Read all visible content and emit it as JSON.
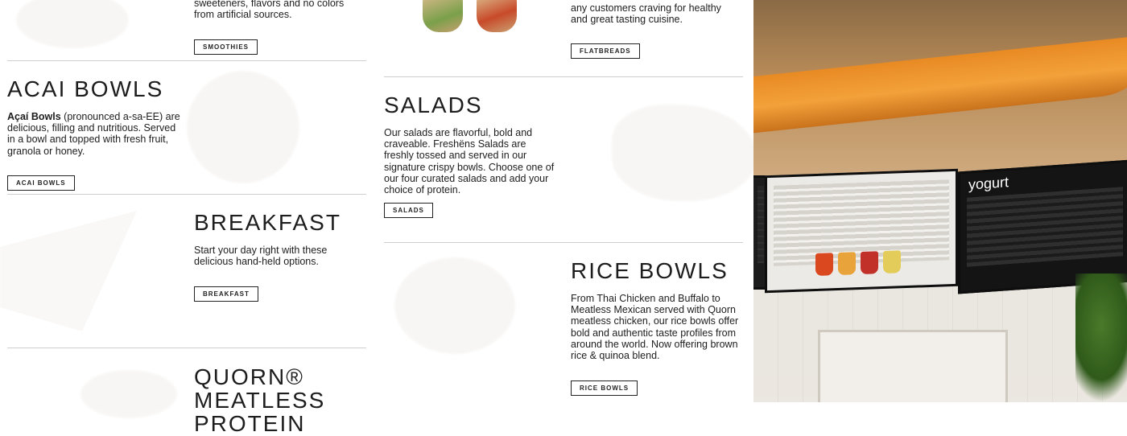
{
  "sections": {
    "smoothies": {
      "desc": "sweeteners, flavors and no colors from artificial sources.",
      "button": "SMOOTHIES"
    },
    "acai": {
      "title": "ACAI BOWLS",
      "desc_bold": "Açaí Bowls",
      "desc": " (pronounced a-sa-EE) are delicious, filling and nutritious. Served in a bowl and topped with fresh fruit, granola or honey.",
      "button": "ACAI BOWLS"
    },
    "breakfast": {
      "title": "BREAKFAST",
      "desc": "Start your day right with these delicious hand-held options.",
      "button": "BREAKFAST"
    },
    "quorn": {
      "title": "QUORN® MEATLESS PROTEIN"
    },
    "flatbreads": {
      "desc": "any customers craving for healthy and great tasting cuisine.",
      "button": "FLATBREADS"
    },
    "salads": {
      "title": "SALADS",
      "desc": "Our salads are flavorful, bold and craveable. Freshëns Salads are freshly tossed and served in our signature crispy bowls. Choose one of our four curated salads and add your choice of protein.",
      "button": "SALADS"
    },
    "rice": {
      "title": "RICE BOWLS",
      "desc": "From Thai Chicken and Buffalo to Meatless Mexican served with Quorn meatless chicken, our rice bowls offer bold and authentic taste profiles from around the world. Now offering brown rice & quinoa blend.",
      "button": "RICE BOWLS"
    }
  },
  "photo": {
    "menu_board_heading": "yogurt",
    "colors": {
      "orange": "#f3a13a",
      "screen": "#1c1c1c"
    }
  }
}
